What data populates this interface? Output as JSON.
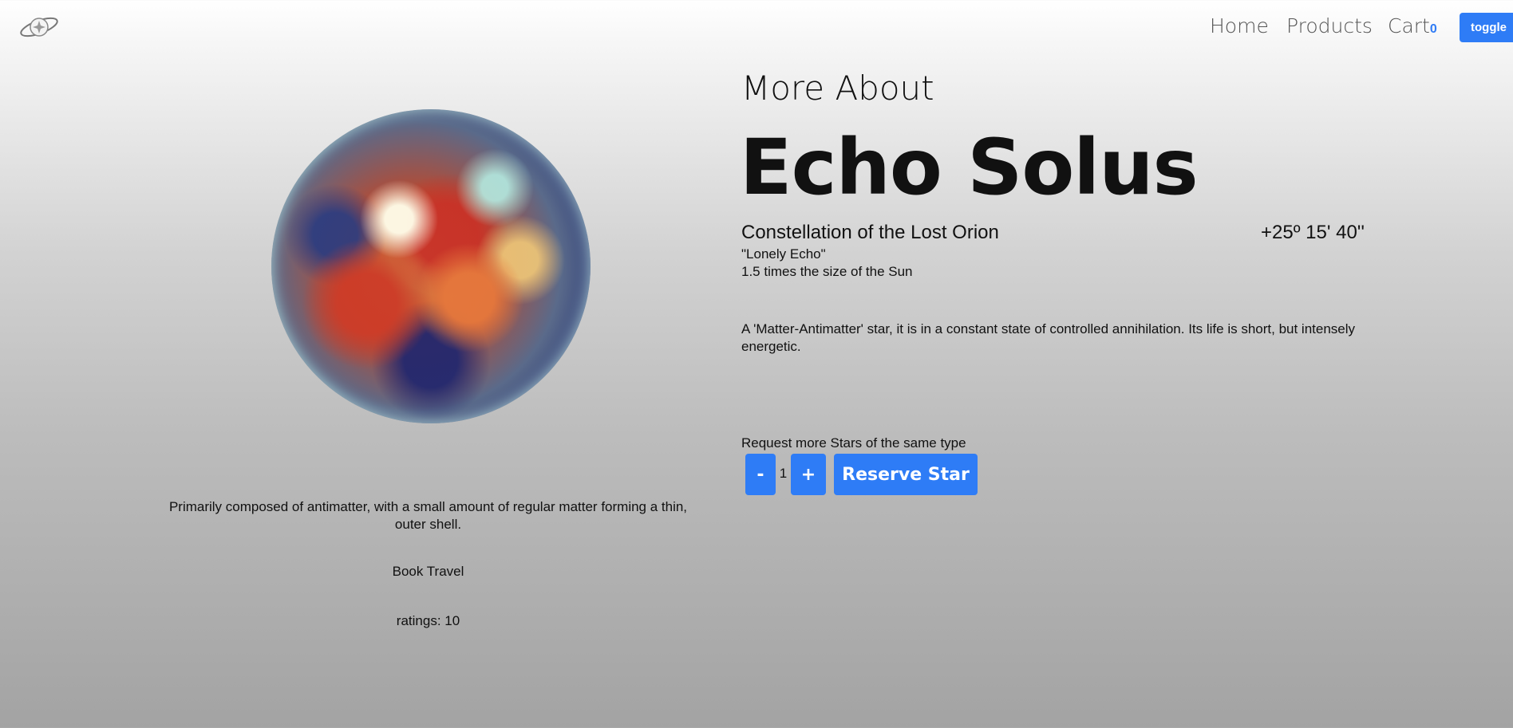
{
  "nav": {
    "home": "Home",
    "products": "Products",
    "cart": "Cart",
    "cart_count": "0",
    "toggle": "toggle"
  },
  "product": {
    "intro": "More About",
    "name": "Echo Solus",
    "constellation": "Constellation of the Lost Orion",
    "coordinates": "+25º 15' 40''",
    "nickname": "\"Lonely Echo\"",
    "size": "1.5 times the size of the Sun",
    "description": "A 'Matter-Antimatter' star, it is in a constant state of controlled annihilation. Its life is short, but intensely energetic.",
    "composition": "Primarily composed of antimatter, with a small amount of regular matter forming a thin, outer shell.",
    "book_travel": "Book Travel",
    "ratings": "ratings: 10"
  },
  "order": {
    "request_label": "Request more Stars of the same type",
    "decrement": "-",
    "quantity": "1",
    "increment": "+",
    "reserve": "Reserve Star"
  },
  "colors": {
    "accent": "#2e7cf6",
    "cart_count": "#2f7bf5"
  },
  "icons": {
    "logo": "planet-ring-logo-icon",
    "star_image": "star-photo"
  }
}
